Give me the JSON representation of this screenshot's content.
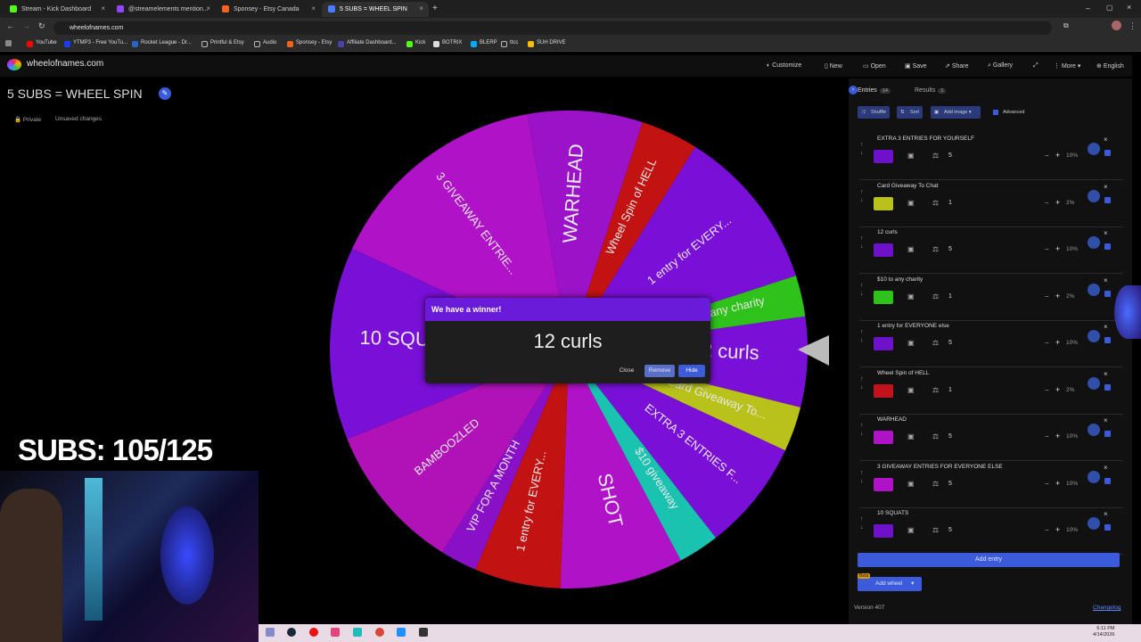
{
  "browser": {
    "tabs": [
      {
        "label": "Stream - Kick Dashboard",
        "color": "#53fc18"
      },
      {
        "label": "@streamelements mention...",
        "color": "#9146ff"
      },
      {
        "label": "Sponsey - Etsy Canada",
        "color": "#f1641e"
      },
      {
        "label": "5 SUBS = WHEEL SPIN",
        "color": "#4a7cff"
      }
    ],
    "url": "wheelofnames.com",
    "bookmarks": [
      "YouTube",
      "YTMP3 - Free YouTu...",
      "Rocket League - Dr...",
      "Printful & Etsy",
      "Audio",
      "Sponsey - Etsy",
      "Affiliate Dashboard...",
      "Kick",
      "BOTRIX",
      "BLERP",
      "ttcc",
      "SUH DRIVE"
    ]
  },
  "site": {
    "logo": "wheelofnames.com",
    "header_buttons": [
      "Customize",
      "New",
      "Open",
      "Save",
      "Share",
      "Gallery",
      "More",
      "English"
    ]
  },
  "wheel_title": "5 SUBS = WHEEL SPIN",
  "status": {
    "private": "Private",
    "unsaved": "Unsaved changes"
  },
  "overlay": {
    "subs": "SUBS: 105/125"
  },
  "wheel": {
    "labels": [
      "WARHEAD",
      "Wheel Spin of HELL",
      "1 entry for EVERY...",
      "$10 to any charity",
      "12 curls",
      "Card Giveaway To...",
      "EXTRA 3 ENTRIES F...",
      "$10 giveaway",
      "SHOT",
      "1 entry for EVERY...",
      "VIP FOR A MONTH",
      "BAMBOOZLED",
      "10 SQUATS",
      "3 GIVEAWAY ENTRIE..."
    ]
  },
  "dialog": {
    "header": "We have a winner!",
    "winner": "12 curls",
    "close": "Close",
    "remove": "Remove",
    "hide": "Hide"
  },
  "panel": {
    "entries_tab": "Entries",
    "entries_count": "14",
    "results_tab": "Results",
    "results_count": "1",
    "shuffle": "Shuffle",
    "sort": "Sort",
    "add_image": "Add image",
    "advanced": "Advanced",
    "entries": [
      {
        "name": "EXTRA 3 ENTRIES FOR YOURSELF",
        "color": "#6d12c8",
        "weight": "5",
        "pct": "10%"
      },
      {
        "name": "Card Giveaway To Chat",
        "color": "#b8c21a",
        "weight": "1",
        "pct": "2%"
      },
      {
        "name": "12 curls",
        "color": "#6d12c8",
        "weight": "5",
        "pct": "10%"
      },
      {
        "name": "$10 to any charity",
        "color": "#2ec21a",
        "weight": "1",
        "pct": "2%"
      },
      {
        "name": "1 entry for EVERYONE else",
        "color": "#6d12c8",
        "weight": "5",
        "pct": "10%"
      },
      {
        "name": "Wheel Spin of HELL",
        "color": "#c2121a",
        "weight": "1",
        "pct": "2%"
      },
      {
        "name": "WARHEAD",
        "color": "#b012c8",
        "weight": "5",
        "pct": "10%"
      },
      {
        "name": "3 GIVEAWAY ENTRIES FOR EVERYONE ELSE",
        "color": "#b012c8",
        "weight": "5",
        "pct": "10%"
      },
      {
        "name": "10 SQUATS",
        "color": "#6d12c8",
        "weight": "5",
        "pct": "10%"
      }
    ],
    "add_entry": "Add entry",
    "beta": "Beta",
    "add_wheel": "Add wheel",
    "version": "Version 407",
    "changelog": "Changelog"
  },
  "clock": {
    "time": "6:11 PM",
    "date": "4/14/2026"
  }
}
